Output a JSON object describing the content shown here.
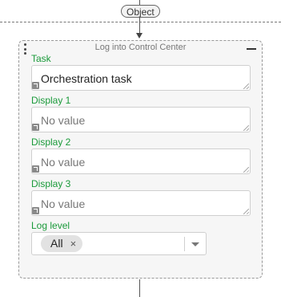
{
  "connector": {
    "object_label": "Object"
  },
  "card": {
    "title": "Log into Control Center"
  },
  "fields": [
    {
      "label": "Task",
      "value": "Orchestration task",
      "is_placeholder": false
    },
    {
      "label": "Display 1",
      "value": "No value",
      "is_placeholder": true
    },
    {
      "label": "Display 2",
      "value": "No value",
      "is_placeholder": true
    },
    {
      "label": "Display 3",
      "value": "No value",
      "is_placeholder": true
    }
  ],
  "log_level": {
    "label": "Log level",
    "selected": "All",
    "remove_glyph": "×"
  },
  "colors": {
    "label_green": "#1a9a3a",
    "card_background": "#f6f6f6"
  },
  "icons": [
    "drag-handle-icon",
    "collapse-icon",
    "expression-icon",
    "resize-grip-icon",
    "chevron-down-icon",
    "remove-icon"
  ]
}
